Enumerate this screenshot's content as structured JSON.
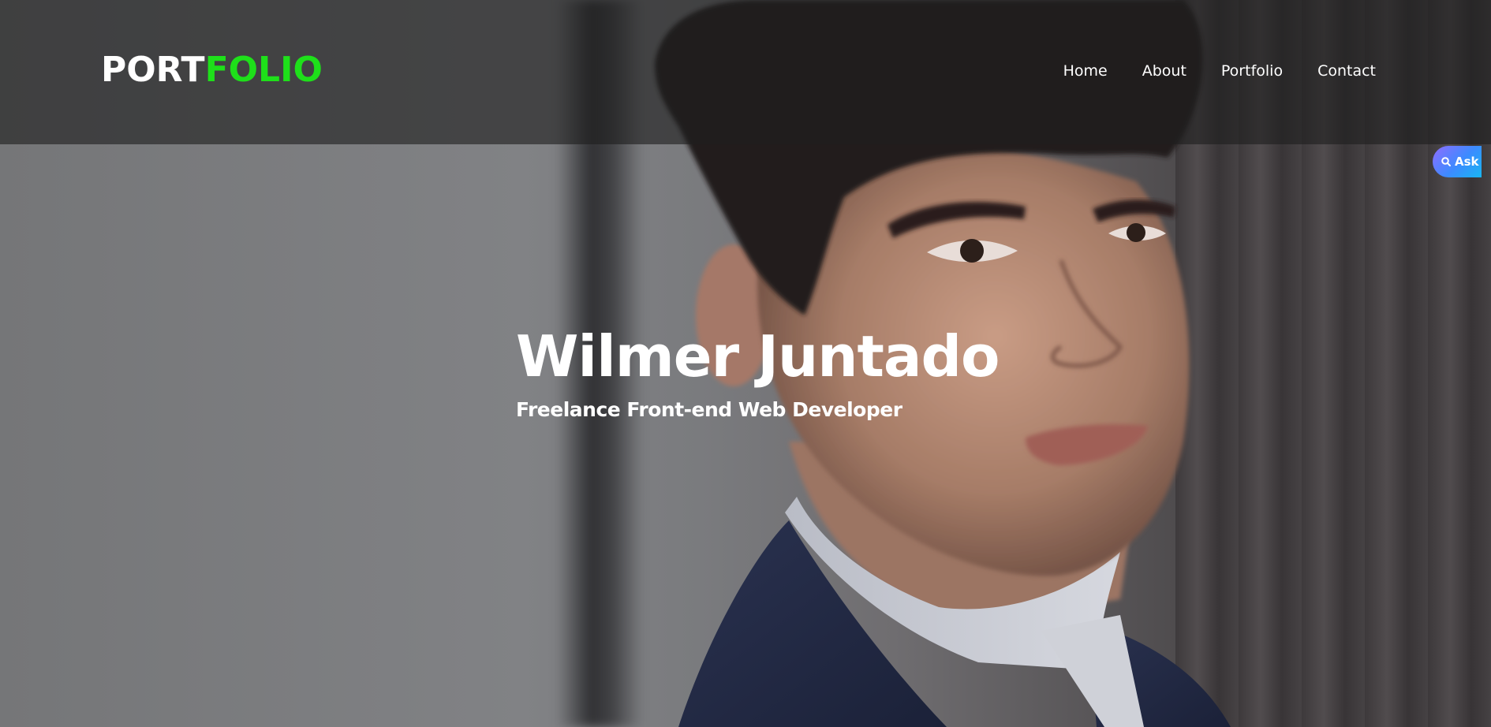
{
  "header": {
    "logo": {
      "part1": "PORT",
      "part2": "FOLIO"
    },
    "nav": [
      {
        "label": "Home"
      },
      {
        "label": "About"
      },
      {
        "label": "Portfolio"
      },
      {
        "label": "Contact"
      }
    ]
  },
  "hero": {
    "name": "Wilmer Juntado",
    "role": "Freelance Front-end Web Developer"
  },
  "ask_widget": {
    "label": "Ask",
    "icon": "search-icon"
  },
  "colors": {
    "accent": "#1ee01a",
    "text": "#ffffff",
    "header_overlay": "#1e1e1e",
    "ask_gradient_start": "#8f6cff",
    "ask_gradient_end": "#18b6f2"
  }
}
